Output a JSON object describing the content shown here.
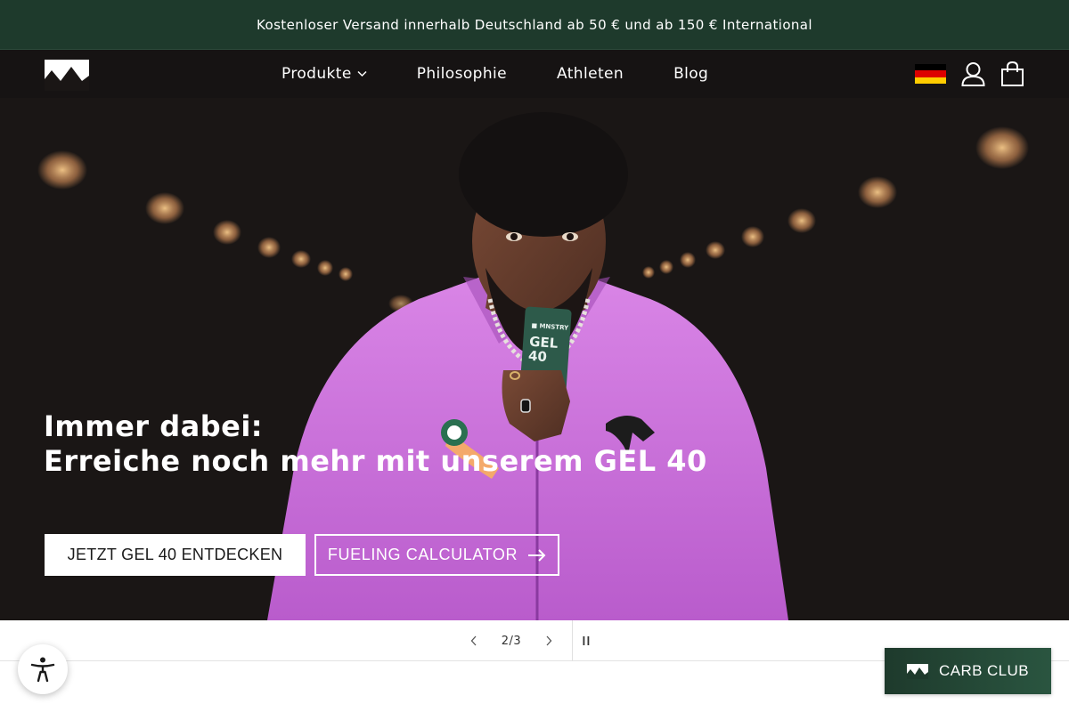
{
  "announcement": {
    "text": "Kostenloser Versand innerhalb Deutschland ab 50 € und ab 150 € International"
  },
  "header": {
    "nav": [
      {
        "label": "Produkte",
        "has_dropdown": true
      },
      {
        "label": "Philosophie"
      },
      {
        "label": "Athleten"
      },
      {
        "label": "Blog"
      }
    ],
    "icons": [
      "logo-mountain-icon",
      "germany-flag-icon",
      "account-icon",
      "cart-icon"
    ]
  },
  "hero": {
    "heading_line1": "Immer dabei:",
    "heading_line2": "Erreiche noch mehr mit unserem GEL 40",
    "cta_primary": "JETZT GEL 40 ENTDECKEN",
    "cta_secondary": "FUELING CALCULATOR",
    "product_text": {
      "brand": "MNSTRY",
      "name": "GEL",
      "number": "40"
    }
  },
  "slider": {
    "counter": "2/3",
    "current": 2,
    "total": 3
  },
  "carb_club": {
    "label": "CARB CLUB"
  },
  "colors": {
    "brand_green": "#1e3a2c",
    "jacket_purple": "#c96ad9",
    "hero_bg": "#1a1615"
  }
}
